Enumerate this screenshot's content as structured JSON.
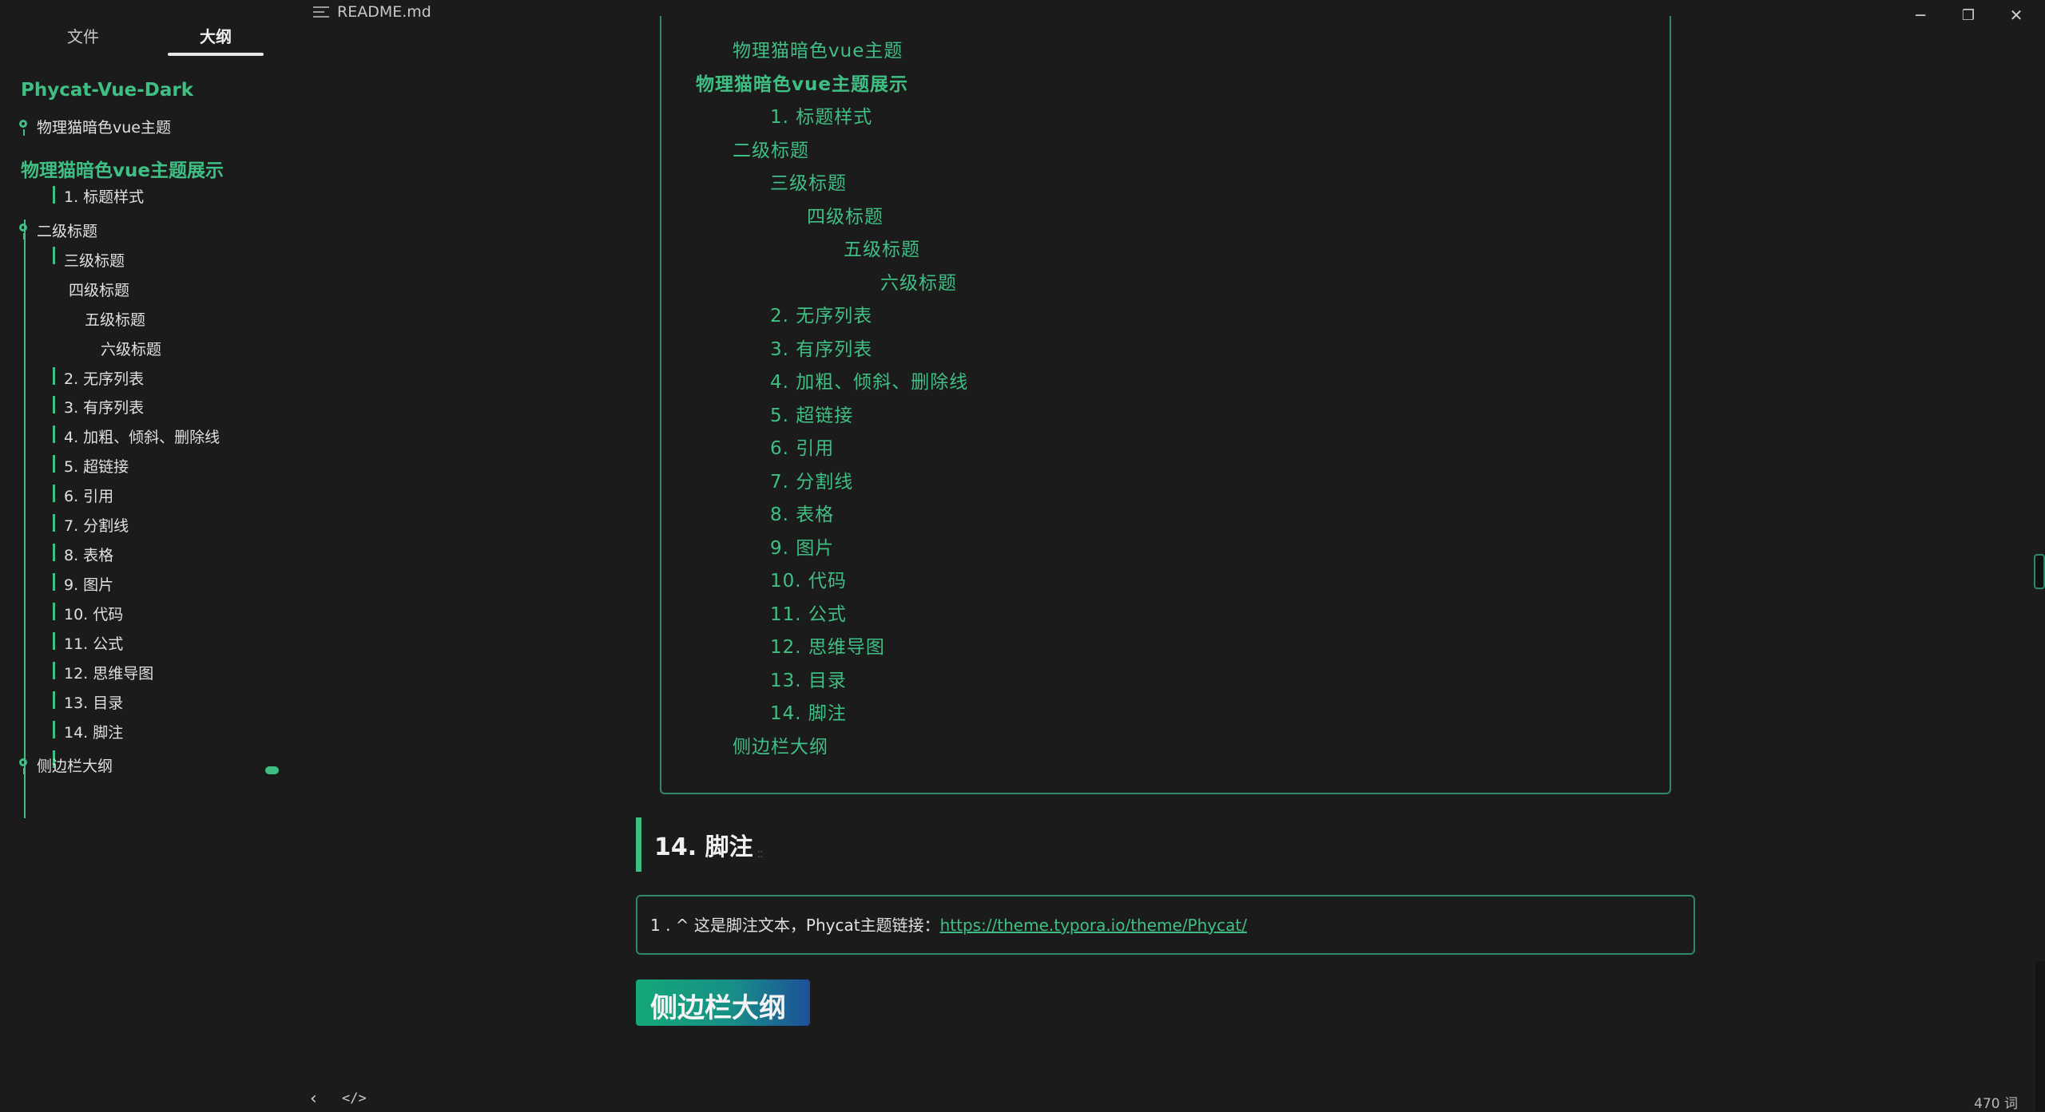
{
  "window": {
    "title": "README.md",
    "minimize": "─",
    "restore": "❐",
    "close": "✕"
  },
  "sidebar": {
    "tabs": [
      "文件",
      "大纲"
    ],
    "outline": [
      "Phycat-Vue-Dark",
      "物理猫暗色vue主题",
      "物理猫暗色vue主题展示",
      "1. 标题样式",
      "二级标题",
      "三级标题",
      "四级标题",
      "五级标题",
      "六级标题",
      "2. 无序列表",
      "3. 有序列表",
      "4. 加粗、倾斜、删除线",
      "5. 超链接",
      "6. 引用",
      "7. 分割线",
      "8. 表格",
      "9. 图片",
      "10. 代码",
      "11. 公式",
      "12. 思维导图",
      "13. 目录",
      "14. 脚注",
      "侧边栏大纲"
    ]
  },
  "toc": [
    "物理猫暗色vue主题",
    "物理猫暗色vue主题展示",
    "1. 标题样式",
    "二级标题",
    "三级标题",
    "四级标题",
    "五级标题",
    "六级标题",
    "2. 无序列表",
    "3. 有序列表",
    "4. 加粗、倾斜、删除线",
    "5. 超链接",
    "6. 引用",
    "7. 分割线",
    "8. 表格",
    "9. 图片",
    "10. 代码",
    "11. 公式",
    "12. 思维导图",
    "13. 目录",
    "14. 脚注",
    "侧边栏大纲"
  ],
  "content": {
    "footnote_heading": "14. 脚注",
    "footnote_text": "1 . ^ 这是脚注文本，Phycat主题链接：",
    "footnote_link": "https://theme.typora.io/theme/Phycat/",
    "sidebar_heading": "侧边栏大纲"
  },
  "status": {
    "back": "‹",
    "source": "</>",
    "word_count": "470 词"
  },
  "colors": {
    "accent": "#3fbf84",
    "background": "#1b1b1b"
  }
}
